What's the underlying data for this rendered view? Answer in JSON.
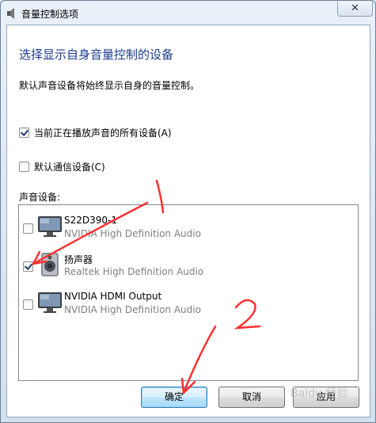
{
  "window": {
    "title": "音量控制选项",
    "close_label": "✕"
  },
  "dialog": {
    "heading": "选择显示自身音量控制的设备",
    "description": "默认声音设备将始终显示自身的音量控制。",
    "options": [
      {
        "label": "当前正在播放声音的所有设备(A)",
        "checked": true
      },
      {
        "label": "默认通信设备(C)",
        "checked": false
      }
    ],
    "devices_label": "声音设备:",
    "devices": [
      {
        "name": "S22D390-1",
        "subtitle": "NVIDIA High Definition Audio",
        "checked": false,
        "icon": "monitor-icon"
      },
      {
        "name": "扬声器",
        "subtitle": "Realtek High Definition Audio",
        "checked": true,
        "icon": "speaker-icon"
      },
      {
        "name": "NVIDIA HDMI Output",
        "subtitle": "NVIDIA High Definition Audio",
        "checked": false,
        "icon": "monitor-icon"
      }
    ],
    "buttons": {
      "ok": "确定",
      "cancel": "取消",
      "apply": "应用"
    }
  },
  "annotations": {
    "step1": "1",
    "step2": "2",
    "color": "#ff3030"
  },
  "watermark": "Baidu 经验"
}
